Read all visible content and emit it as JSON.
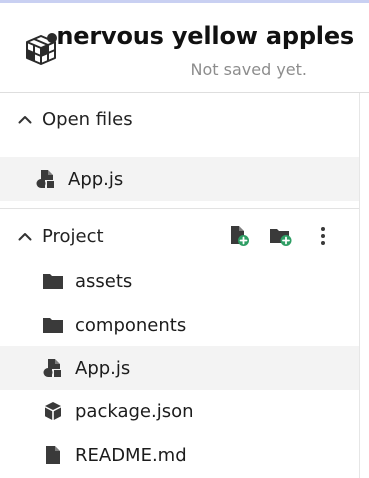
{
  "header": {
    "project_name": "nervous yellow apples",
    "save_status": "Not saved yet."
  },
  "open_files": {
    "heading": "Open files",
    "items": [
      {
        "label": "App.js",
        "icon": "js-file-icon"
      }
    ]
  },
  "project": {
    "heading": "Project",
    "actions": [
      "new-file-icon",
      "new-folder-icon",
      "more-options-icon"
    ],
    "items": [
      {
        "label": "assets",
        "icon": "folder-icon"
      },
      {
        "label": "components",
        "icon": "folder-icon"
      },
      {
        "label": "App.js",
        "icon": "js-file-icon",
        "selected": true
      },
      {
        "label": "package.json",
        "icon": "package-icon"
      },
      {
        "label": "README.md",
        "icon": "file-icon"
      }
    ]
  },
  "colors": {
    "accent_green": "#2e9e64",
    "icon_dark": "#3a3a3a",
    "selected_bg": "#f3f3f3",
    "muted_text": "#8d8d8d"
  }
}
